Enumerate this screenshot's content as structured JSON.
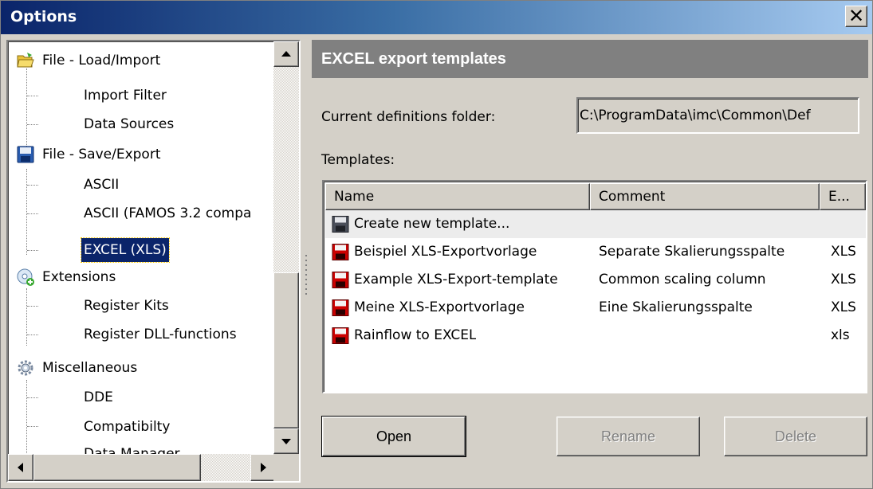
{
  "window": {
    "title": "Options",
    "close_glyph": "✕"
  },
  "tree": {
    "items": [
      {
        "label": "File - Load/Import",
        "level": 0,
        "icon": "folder-open-icon"
      },
      {
        "label": "Import Filter",
        "level": 1
      },
      {
        "label": "Data Sources",
        "level": 1
      },
      {
        "label": "File - Save/Export",
        "level": 0,
        "icon": "floppy-disk-icon"
      },
      {
        "label": "ASCII",
        "level": 1
      },
      {
        "label": "ASCII (FAMOS 3.2 compa",
        "level": 1
      },
      {
        "label": "EXCEL (XLS)",
        "level": 1,
        "selected": true
      },
      {
        "label": "Extensions",
        "level": 0,
        "icon": "extension-cd-icon"
      },
      {
        "label": "Register Kits",
        "level": 1
      },
      {
        "label": "Register DLL-functions",
        "level": 1
      },
      {
        "label": "Miscellaneous",
        "level": 0,
        "icon": "gear-icon"
      },
      {
        "label": "DDE",
        "level": 1
      },
      {
        "label": "Compatibilty",
        "level": 1
      },
      {
        "label": "Data Manager",
        "level": 1
      }
    ]
  },
  "section": {
    "title": "EXCEL export templates"
  },
  "folder": {
    "label": "Current definitions folder:",
    "value": "C:\\ProgramData\\imc\\Common\\Def"
  },
  "templates": {
    "label": "Templates:",
    "columns": [
      "Name",
      "Comment",
      "E..."
    ],
    "rows": [
      {
        "name": "Create new template...",
        "comment": "",
        "ext": "",
        "icon": "floppy-disk-gray-icon",
        "selected": true
      },
      {
        "name": "Beispiel XLS-Exportvorlage",
        "comment": "Separate Skalierungsspalte",
        "ext": "XLS",
        "icon": "floppy-disk-red-icon"
      },
      {
        "name": "Example XLS-Export-template",
        "comment": "Common scaling column",
        "ext": "XLS",
        "icon": "floppy-disk-red-icon"
      },
      {
        "name": "Meine XLS-Exportvorlage",
        "comment": "Eine Skalierungsspalte",
        "ext": "XLS",
        "icon": "floppy-disk-red-icon"
      },
      {
        "name": "Rainflow to EXCEL",
        "comment": "",
        "ext": "xls",
        "icon": "floppy-disk-red-icon"
      }
    ]
  },
  "buttons": {
    "open": "Open",
    "rename": "Rename",
    "delete": "Delete"
  },
  "colors": {
    "titlebar_start": "#0a246a",
    "titlebar_end": "#a6caf0",
    "section_header": "#808080",
    "selection": "#0a246a",
    "disk_red": "#cc0000"
  }
}
